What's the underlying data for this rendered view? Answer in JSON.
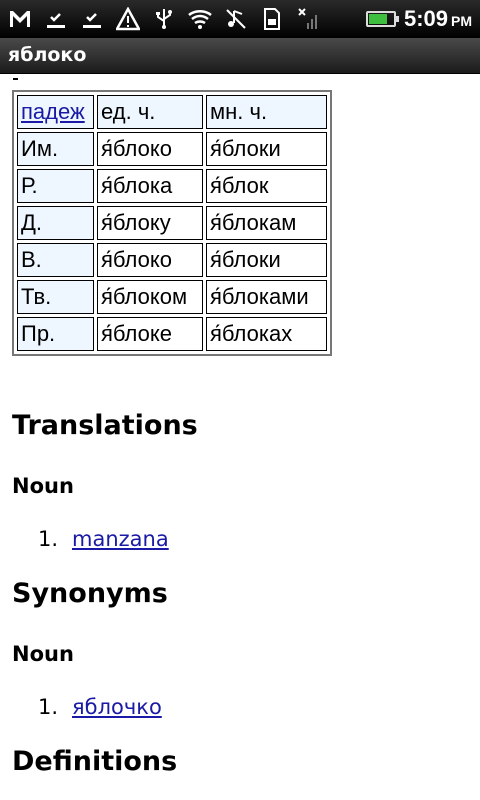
{
  "status_bar": {
    "time": "5:09",
    "ampm": "PM",
    "battery_level": 0.75,
    "icons": [
      "gmail-icon",
      "download-complete-icon",
      "download-complete-icon",
      "warning-icon",
      "usb-icon",
      "wifi-icon",
      "music-muted-icon",
      "sd-card-icon",
      "no-signal-icon",
      "battery-charging-icon"
    ]
  },
  "title": "яблоко",
  "declension": {
    "header": [
      "падеж",
      "ед. ч.",
      "мн. ч."
    ],
    "rows": [
      [
        "Им.",
        "я́блоко",
        "я́блоки"
      ],
      [
        "Р.",
        "я́блока",
        "я́блок"
      ],
      [
        "Д.",
        "я́блоку",
        "я́блокам"
      ],
      [
        "В.",
        "я́блоко",
        "я́блоки"
      ],
      [
        "Тв.",
        "я́блоком",
        "я́блоками"
      ],
      [
        "Пр.",
        "я́блоке",
        "я́блоках"
      ]
    ]
  },
  "sections": {
    "translations": {
      "heading": "Translations",
      "subheading": "Noun",
      "items": [
        {
          "num": "1.",
          "text": "manzana"
        }
      ]
    },
    "synonyms": {
      "heading": "Synonyms",
      "subheading": "Noun",
      "items": [
        {
          "num": "1.",
          "text": "яблочко"
        }
      ]
    },
    "definitions": {
      "heading": "Definitions"
    }
  }
}
